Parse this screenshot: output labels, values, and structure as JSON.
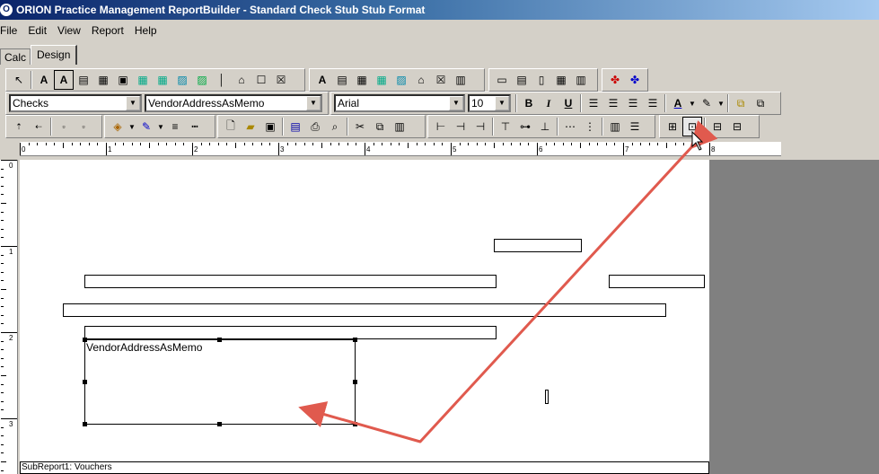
{
  "window": {
    "title": "ORION Practice Management ReportBuilder - Standard Check Stub Stub Format"
  },
  "menu": [
    "File",
    "Edit",
    "View",
    "Report",
    "Help"
  ],
  "tabs": [
    {
      "label": "Calc"
    },
    {
      "label": "Design"
    }
  ],
  "format_toolbar": {
    "dataset": "Checks",
    "field": "VendorAddressAsMemo",
    "font": "Arial",
    "font_size": "10"
  },
  "ruler": {
    "h_labels": [
      "0",
      "1",
      "2",
      "3",
      "4",
      "5",
      "6",
      "7",
      "8"
    ],
    "v_labels": [
      "0",
      "1",
      "2",
      "3"
    ]
  },
  "design": {
    "selected_memo_label": "VendorAddressAsMemo",
    "subreport_label": "SubReport1: Vouchers"
  },
  "colors": {
    "annotation_arrow": "#e05a4e",
    "title_bar": "#0a246a"
  }
}
